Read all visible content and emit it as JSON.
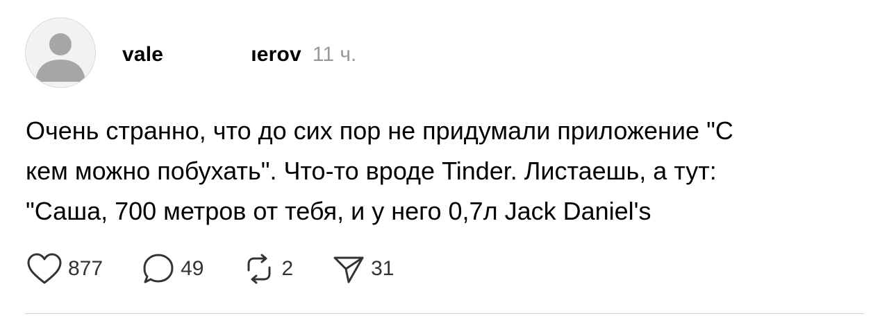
{
  "post": {
    "author": {
      "name_start": "vale",
      "name_end": "ıerov"
    },
    "timestamp": "11 ч.",
    "text": "Очень странно, что до сих пор не придумали приложение \"С\nкем можно побухать\". Что-то вроде Tinder. Листаешь, а тут:\n\"Саша, 700 метров от тебя, и у него 0,7л Jack Daniel's",
    "actions": {
      "likes": "877",
      "comments": "49",
      "reposts": "2",
      "shares": "31"
    }
  },
  "colors": {
    "text": "#000000",
    "muted": "#999999",
    "icon": "#333333",
    "avatar_bg": "#f2f2f2",
    "avatar_fg": "#a6a6a6",
    "divider": "#d6d6d6"
  },
  "icons": [
    "avatar-placeholder-icon",
    "heart-icon",
    "comment-bubble-icon",
    "repost-icon",
    "share-send-icon"
  ]
}
